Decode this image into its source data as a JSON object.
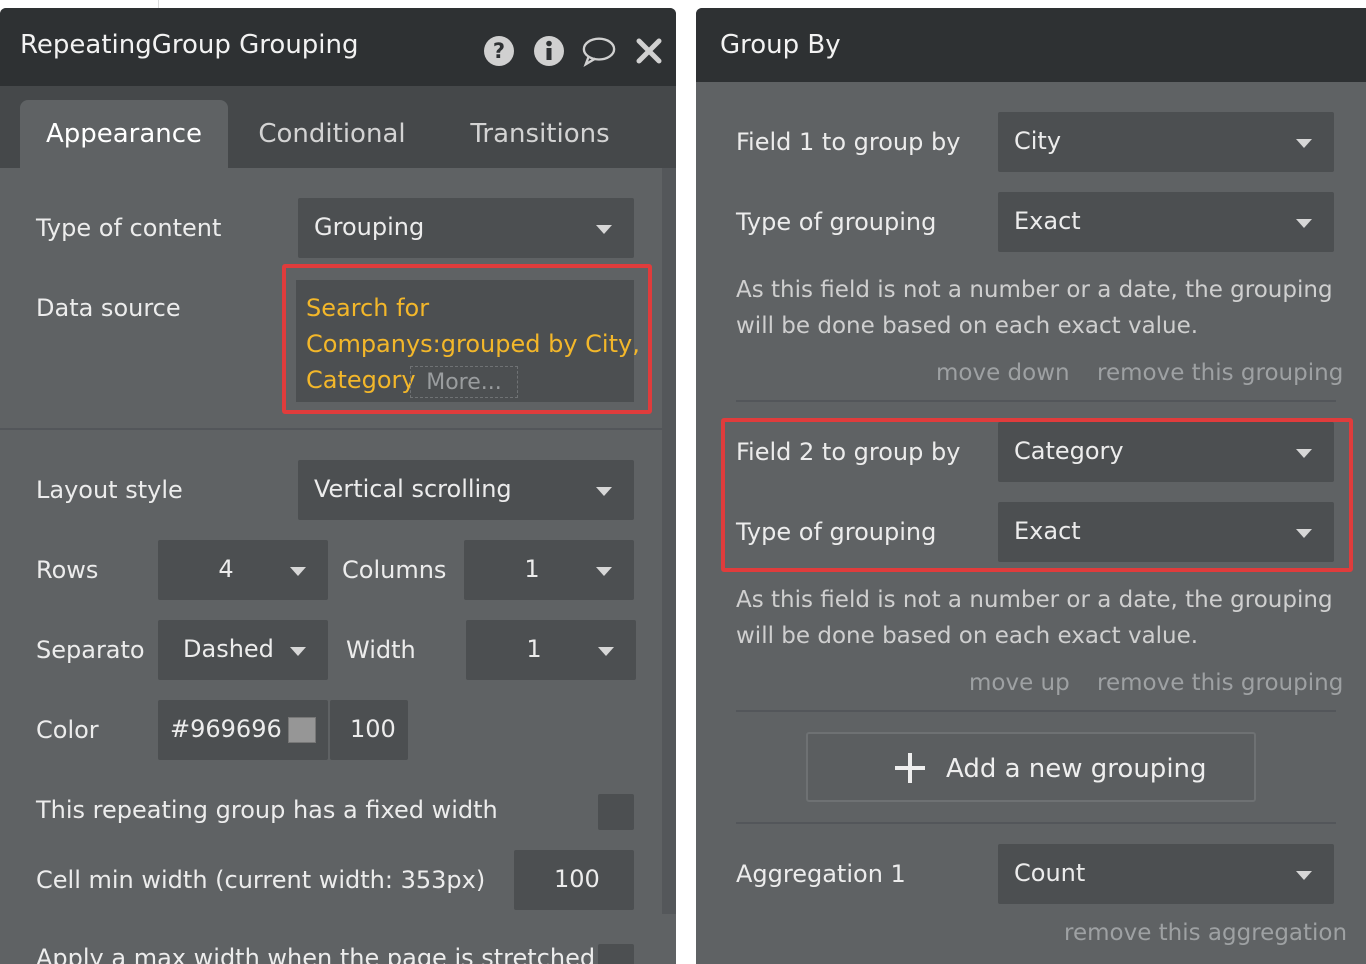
{
  "left_panel": {
    "title": "RepeatingGroup Grouping",
    "icons": [
      "help-icon",
      "info-icon",
      "comment-icon",
      "close-icon"
    ],
    "tabs": [
      {
        "label": "Appearance",
        "active": true
      },
      {
        "label": "Conditional",
        "active": false
      },
      {
        "label": "Transitions",
        "active": false
      }
    ],
    "type_of_content": {
      "label": "Type of content",
      "value": "Grouping"
    },
    "data_source": {
      "label": "Data source",
      "lines": [
        "Search for",
        "Companys:grouped by City,",
        "Category"
      ],
      "more": "More..."
    },
    "layout_style": {
      "label": "Layout style",
      "value": "Vertical scrolling"
    },
    "rows": {
      "label": "Rows",
      "value": "4"
    },
    "columns": {
      "label": "Columns",
      "value": "1"
    },
    "separator": {
      "label": "Separato",
      "value": "Dashed"
    },
    "width": {
      "label": "Width",
      "value": "1"
    },
    "color": {
      "label": "Color",
      "hex": "#969696",
      "opacity": "100",
      "swatch": "#969696"
    },
    "fixed_width": {
      "label": "This repeating group has a fixed width",
      "checked": false
    },
    "cell_min_width": {
      "label": "Cell min width (current width: 353px)",
      "value": "100"
    },
    "max_width": {
      "label": "Apply a max width when the page is stretched",
      "checked": false
    }
  },
  "right_panel": {
    "title": "Group By",
    "grouping_1": {
      "field_label": "Field 1 to group by",
      "field_value": "City",
      "type_label": "Type of grouping",
      "type_value": "Exact",
      "hint_line1": "As this field is not a number or a date, the grouping",
      "hint_line2": "will be done based on each exact value.",
      "move": "move down",
      "remove": "remove this grouping"
    },
    "grouping_2": {
      "field_label": "Field 2 to group by",
      "field_value": "Category",
      "type_label": "Type of grouping",
      "type_value": "Exact",
      "hint_line1": "As this field is not a number or a date, the grouping",
      "hint_line2": "will be done based on each exact value.",
      "move": "move up",
      "remove": "remove this grouping"
    },
    "add_grouping": "Add a new grouping",
    "aggregation_1": {
      "label": "Aggregation 1",
      "value": "Count",
      "remove": "remove this aggregation"
    }
  },
  "colors": {
    "panel_bg": "#5f6264",
    "header_bg": "#2e3133",
    "field_bg": "#4c4f51",
    "dynamic_text": "#f3b72a",
    "highlight": "#e03c3c"
  }
}
